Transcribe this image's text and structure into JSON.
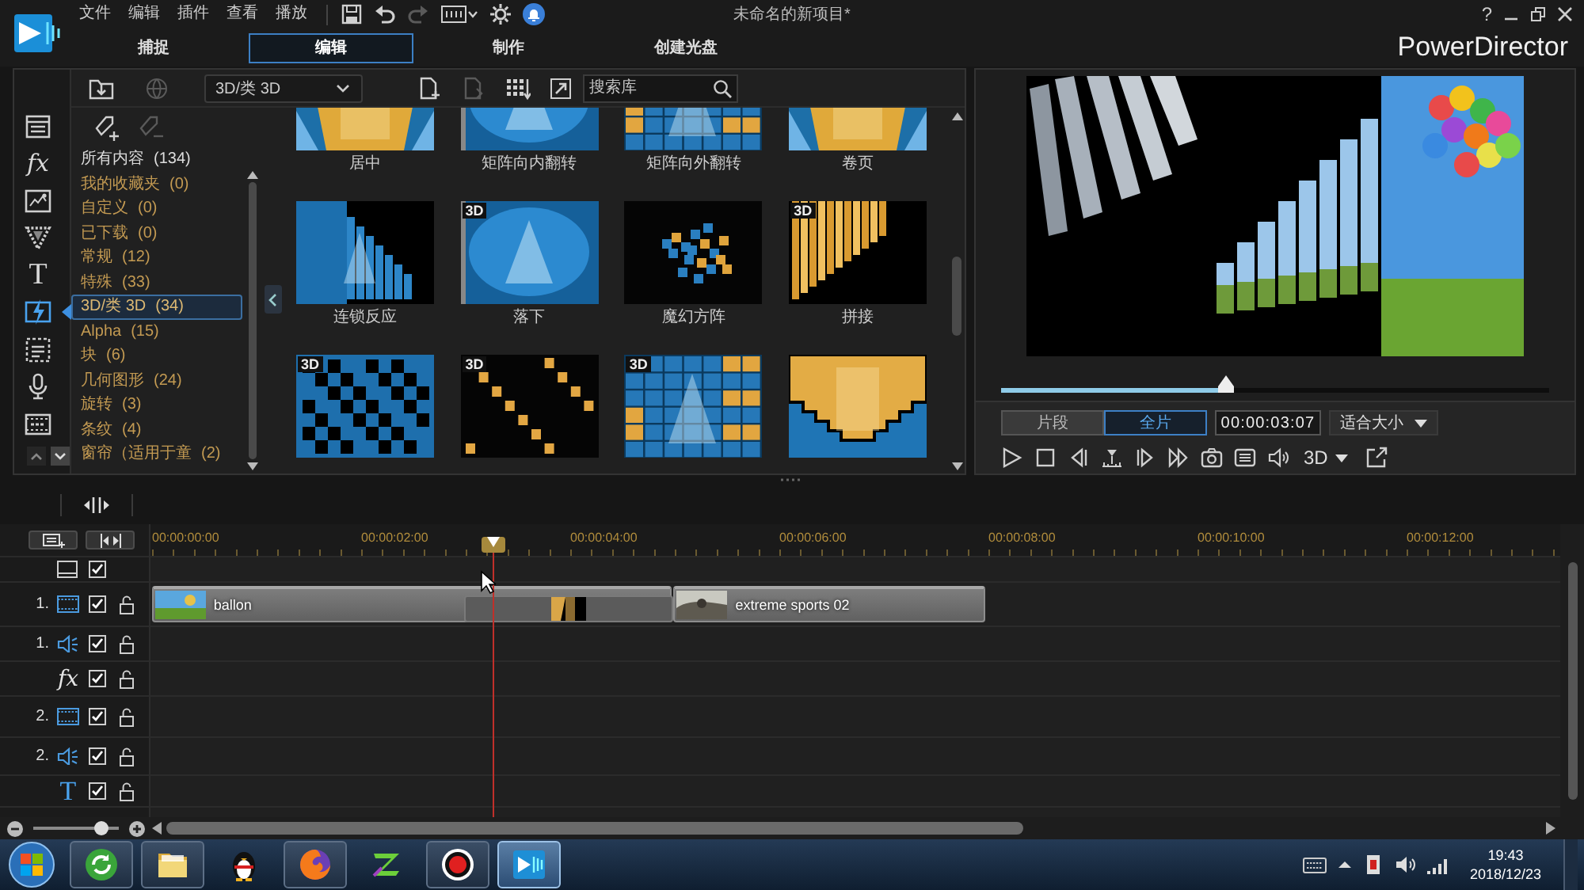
{
  "window": {
    "title": "未命名的新项目*",
    "help": "?",
    "brand": "PowerDirector"
  },
  "menu": [
    "文件",
    "编辑",
    "插件",
    "查看",
    "播放"
  ],
  "toolbar": [
    {
      "kind": "save",
      "disabled": false
    },
    {
      "kind": "undo",
      "disabled": false
    },
    {
      "kind": "redo",
      "disabled": true
    },
    {
      "kind": "aspect",
      "disabled": false
    },
    {
      "kind": "settings",
      "disabled": false
    },
    {
      "kind": "notifications",
      "disabled": false
    }
  ],
  "modes": [
    {
      "label": "捕捉",
      "selected": false
    },
    {
      "label": "编辑",
      "selected": true
    },
    {
      "label": "制作",
      "selected": false
    },
    {
      "label": "创建光盘",
      "selected": false
    }
  ],
  "library": {
    "rooms": [
      {
        "kind": "media",
        "selected": false
      },
      {
        "kind": "effects",
        "label": "fx",
        "selected": false
      },
      {
        "kind": "pip",
        "selected": false
      },
      {
        "kind": "particle",
        "selected": false
      },
      {
        "kind": "title",
        "label": "T",
        "selected": false
      },
      {
        "kind": "transition",
        "selected": true
      },
      {
        "kind": "subtitle",
        "selected": false
      },
      {
        "kind": "voice",
        "selected": false
      },
      {
        "kind": "chapter",
        "selected": false
      }
    ],
    "tools_left": [
      {
        "kind": "import",
        "disabled": false
      },
      {
        "kind": "online",
        "disabled": true
      }
    ],
    "filter": "3D/类 3D",
    "tools_right": [
      {
        "kind": "new",
        "disabled": false
      },
      {
        "kind": "export",
        "disabled": true
      },
      {
        "kind": "arrange",
        "disabled": false
      },
      {
        "kind": "expand",
        "disabled": false
      }
    ],
    "search": {
      "placeholder": "搜索库"
    },
    "tags": [
      {
        "kind": "add",
        "disabled": false
      },
      {
        "kind": "remove",
        "disabled": true
      }
    ],
    "categories": [
      {
        "kind": "total",
        "label": "所有内容",
        "count": "(134)",
        "selected": false
      },
      {
        "kind": "group",
        "label": "我的收藏夹",
        "count": "(0)",
        "selected": false
      },
      {
        "kind": "group",
        "label": "自定义",
        "count": "(0)",
        "selected": false
      },
      {
        "kind": "group",
        "label": "已下载",
        "count": "(0)",
        "selected": false
      },
      {
        "kind": "group",
        "label": "常规",
        "count": "(12)",
        "selected": false
      },
      {
        "kind": "group",
        "label": "特殊",
        "count": "(33)",
        "selected": false
      },
      {
        "kind": "group",
        "label": "3D/类 3D",
        "count": "(34)",
        "selected": true
      },
      {
        "kind": "group",
        "label": "Alpha",
        "count": "(15)",
        "selected": false
      },
      {
        "kind": "group",
        "label": "块",
        "count": "(6)",
        "selected": false
      },
      {
        "kind": "group",
        "label": "几何图形",
        "count": "(24)",
        "selected": false
      },
      {
        "kind": "group",
        "label": "旋转",
        "count": "(3)",
        "selected": false
      },
      {
        "kind": "group",
        "label": "条纹",
        "count": "(4)",
        "selected": false
      },
      {
        "kind": "group",
        "label": "窗帘（适用于童",
        "count": "(2)",
        "selected": false
      }
    ],
    "effects": [
      {
        "kind": "gold-b",
        "label": "居中"
      },
      {
        "kind": "blue-a",
        "label": "矩阵向内翻转"
      },
      {
        "kind": "tiles",
        "label": "矩阵向外翻转"
      },
      {
        "kind": "gold-b",
        "label": "卷页"
      },
      {
        "kind": "chain",
        "label": "连锁反应"
      },
      {
        "kind": "blue-a",
        "label": "落下",
        "badge": "3D"
      },
      {
        "kind": "cubes",
        "label": "魔幻方阵"
      },
      {
        "kind": "strips",
        "label": "拼接",
        "badge": "3D"
      },
      {
        "kind": "blocks",
        "badge": "3D"
      },
      {
        "kind": "gold-blocks",
        "badge": "3D"
      },
      {
        "kind": "tiles",
        "badge": "3D"
      },
      {
        "kind": "crown"
      }
    ]
  },
  "preview": {
    "scrub": {
      "level": 0.41
    },
    "ranges": [
      {
        "label": "片段",
        "selected": false
      },
      {
        "label": "全片",
        "selected": true
      }
    ],
    "timecode": "00:00:03:07",
    "fit": "适合大小",
    "stereo": "3D"
  },
  "timeline": {
    "ruler": [
      "00:00:00:00",
      "00:00:02:00",
      "00:00:04:00",
      "00:00:06:00",
      "00:00:08:00",
      "00:00:10:00",
      "00:00:12:00"
    ],
    "playhead": {
      "level": 0.243
    },
    "tracks": [
      {
        "kind": "master",
        "enabled": true
      },
      {
        "kind": "video",
        "number": "1.",
        "enabled": true,
        "locked": false,
        "clips": [
          {
            "kind": "video",
            "label": "ballon"
          },
          {
            "kind": "transition"
          },
          {
            "kind": "video",
            "label": "extreme sports 02"
          }
        ]
      },
      {
        "kind": "audio",
        "number": "1.",
        "enabled": true,
        "locked": false
      },
      {
        "kind": "effect",
        "label": "fx",
        "enabled": true,
        "locked": false
      },
      {
        "kind": "video",
        "number": "2.",
        "enabled": true,
        "locked": false
      },
      {
        "kind": "audio",
        "number": "2.",
        "enabled": true,
        "locked": false
      },
      {
        "kind": "title",
        "label": "T",
        "enabled": true,
        "locked": false
      }
    ],
    "zoom": {
      "level": 0.8
    }
  },
  "taskbar": {
    "apps": [
      {
        "kind": "browser",
        "running": true,
        "selected": false
      },
      {
        "kind": "folder",
        "running": true,
        "selected": false
      },
      {
        "kind": "chat",
        "running": false,
        "selected": false
      },
      {
        "kind": "globe",
        "running": true,
        "selected": false
      },
      {
        "kind": "player",
        "running": false,
        "selected": false
      },
      {
        "kind": "recorder",
        "running": true,
        "selected": false
      },
      {
        "kind": "editor",
        "running": true,
        "selected": true
      }
    ],
    "clock": {
      "time": "19:43",
      "date": "2018/12/23"
    }
  }
}
